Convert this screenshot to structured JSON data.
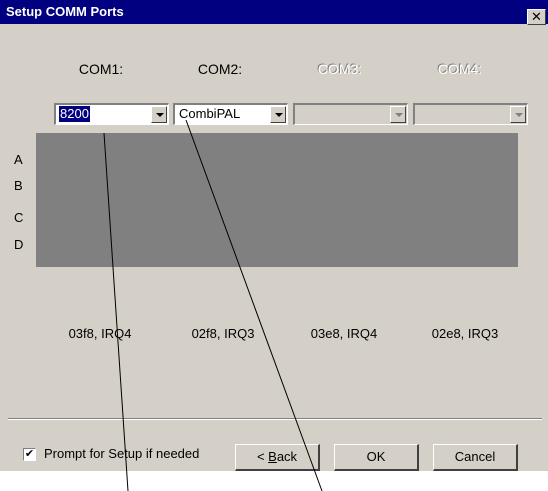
{
  "window": {
    "title": "Setup COMM Ports",
    "close_glyph": "✕"
  },
  "ports": [
    {
      "header": "COM1:",
      "value": "8200",
      "enabled": true,
      "irq": "03f8, IRQ4"
    },
    {
      "header": "COM2:",
      "value": "CombiPAL",
      "enabled": true,
      "irq": "02f8, IRQ3"
    },
    {
      "header": "COM3:",
      "value": "",
      "enabled": false,
      "irq": "03e8, IRQ4"
    },
    {
      "header": "COM4:",
      "value": "",
      "enabled": false,
      "irq": "02e8, IRQ3"
    }
  ],
  "rows": [
    "A",
    "B",
    "C",
    "D"
  ],
  "footer": {
    "prompt_checkbox_label": "Prompt for Setup if needed",
    "prompt_checked": true,
    "back_label_prefix": "< ",
    "back_label_accel": "B",
    "back_label_rest": "ack",
    "ok_label": "OK",
    "cancel_label": "Cancel"
  },
  "colors": {
    "titlebar": "#000080",
    "dialog_face": "#d4d0c8",
    "panel": "#808080",
    "selection": "#000080"
  },
  "icons": {
    "close": "close-icon",
    "dropdown": "chevron-down-icon",
    "check": "checkmark-icon"
  }
}
